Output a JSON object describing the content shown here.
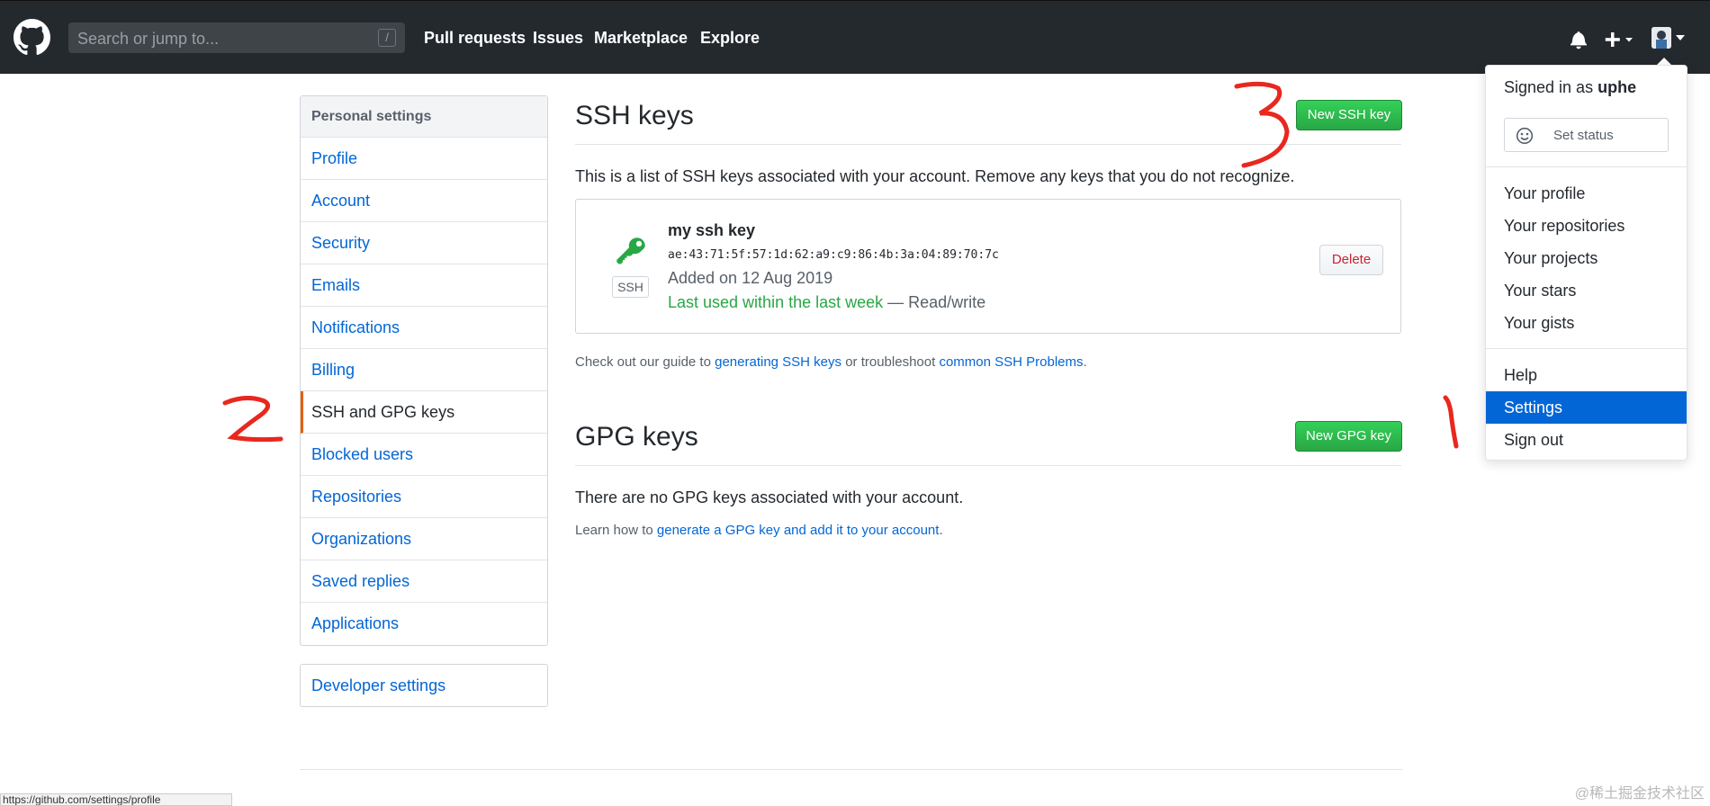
{
  "header": {
    "search_placeholder": "Search or jump to...",
    "search_shortcut": "/",
    "nav": [
      "Pull requests",
      "Issues",
      "Marketplace",
      "Explore"
    ]
  },
  "sidebar": {
    "heading": "Personal settings",
    "items": [
      {
        "label": "Profile",
        "active": false
      },
      {
        "label": "Account",
        "active": false
      },
      {
        "label": "Security",
        "active": false
      },
      {
        "label": "Emails",
        "active": false
      },
      {
        "label": "Notifications",
        "active": false
      },
      {
        "label": "Billing",
        "active": false
      },
      {
        "label": "SSH and GPG keys",
        "active": true
      },
      {
        "label": "Blocked users",
        "active": false
      },
      {
        "label": "Repositories",
        "active": false
      },
      {
        "label": "Organizations",
        "active": false
      },
      {
        "label": "Saved replies",
        "active": false
      },
      {
        "label": "Applications",
        "active": false
      }
    ],
    "developer_settings": "Developer settings"
  },
  "ssh": {
    "title": "SSH keys",
    "new_button": "New SSH key",
    "description": "This is a list of SSH keys associated with your account. Remove any keys that you do not recognize.",
    "key": {
      "badge": "SSH",
      "name": "my ssh key",
      "fingerprint": "ae:43:71:5f:57:1d:62:a9:c9:86:4b:3a:04:89:70:7c",
      "added": "Added on 12 Aug 2019",
      "last_used": "Last used within the last week",
      "access": " — Read/write",
      "delete_label": "Delete"
    },
    "guide_pre": "Check out our guide to ",
    "guide_link1": "generating SSH keys",
    "guide_mid": " or troubleshoot ",
    "guide_link2": "common SSH Problems",
    "guide_post": "."
  },
  "gpg": {
    "title": "GPG keys",
    "new_button": "New GPG key",
    "description": "There are no GPG keys associated with your account.",
    "learn_pre": "Learn how to ",
    "learn_link": "generate a GPG key and add it to your account",
    "learn_post": "."
  },
  "dropdown": {
    "signed_in_prefix": "Signed in as ",
    "username": "uphe",
    "set_status": "Set status",
    "items_group1": [
      "Your profile",
      "Your repositories",
      "Your projects",
      "Your stars",
      "Your gists"
    ],
    "items_group2": [
      {
        "label": "Help",
        "active": false
      },
      {
        "label": "Settings",
        "active": true
      },
      {
        "label": "Sign out",
        "active": false
      }
    ]
  },
  "status_bar_url": "https://github.com/settings/profile",
  "watermark": "@稀土掘金技术社区",
  "annotations": [
    "1",
    "2",
    "3"
  ],
  "colors": {
    "header_bg": "#24292e",
    "link": "#0366d6",
    "green": "#28a745",
    "active_border": "#e36209",
    "annotation": "#e8281e",
    "danger": "#cb2431"
  }
}
